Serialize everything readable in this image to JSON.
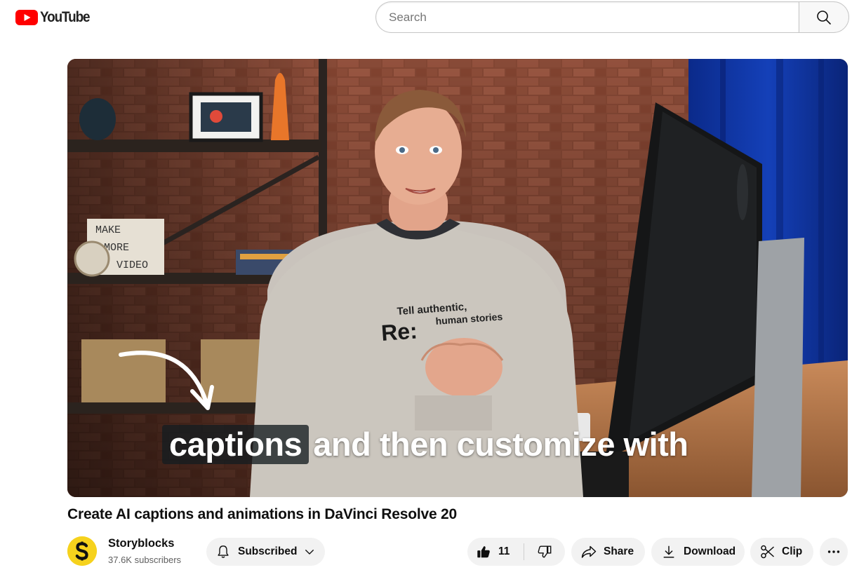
{
  "header": {
    "logo_text": "YouTube",
    "search_placeholder": "Search"
  },
  "video": {
    "caption_highlight": "captions",
    "caption_rest": "and then customize with",
    "title": "Create AI captions and animations in DaVinci Resolve 20"
  },
  "channel": {
    "avatar_letter": "S",
    "name": "Storyblocks",
    "subscribers": "37.6K subscribers"
  },
  "actions": {
    "subscribe_label": "Subscribed",
    "like_count": "11",
    "share_label": "Share",
    "download_label": "Download",
    "clip_label": "Clip"
  },
  "colors": {
    "brand_red": "#ff0000",
    "avatar_yellow": "#f6d21d",
    "pill_bg": "#f2f2f2"
  }
}
